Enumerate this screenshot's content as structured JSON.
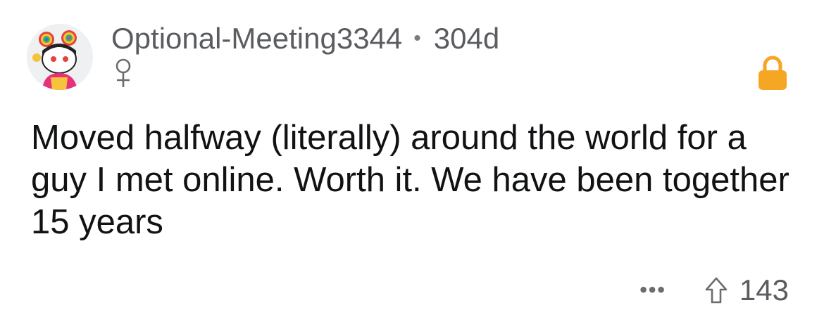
{
  "comment": {
    "author": "Optional-Meeting3344",
    "separator": "•",
    "age": "304d",
    "flair_icon": "female-sign-icon",
    "locked_icon": "lock-icon",
    "lock_color": "#f5a623",
    "body": "Moved halfway (literally) around the world for a guy I met online. Worth it. We have been together 15 years",
    "actions": {
      "more_label": "•••",
      "upvote_icon": "upvote-arrow-icon",
      "score": "143"
    }
  }
}
